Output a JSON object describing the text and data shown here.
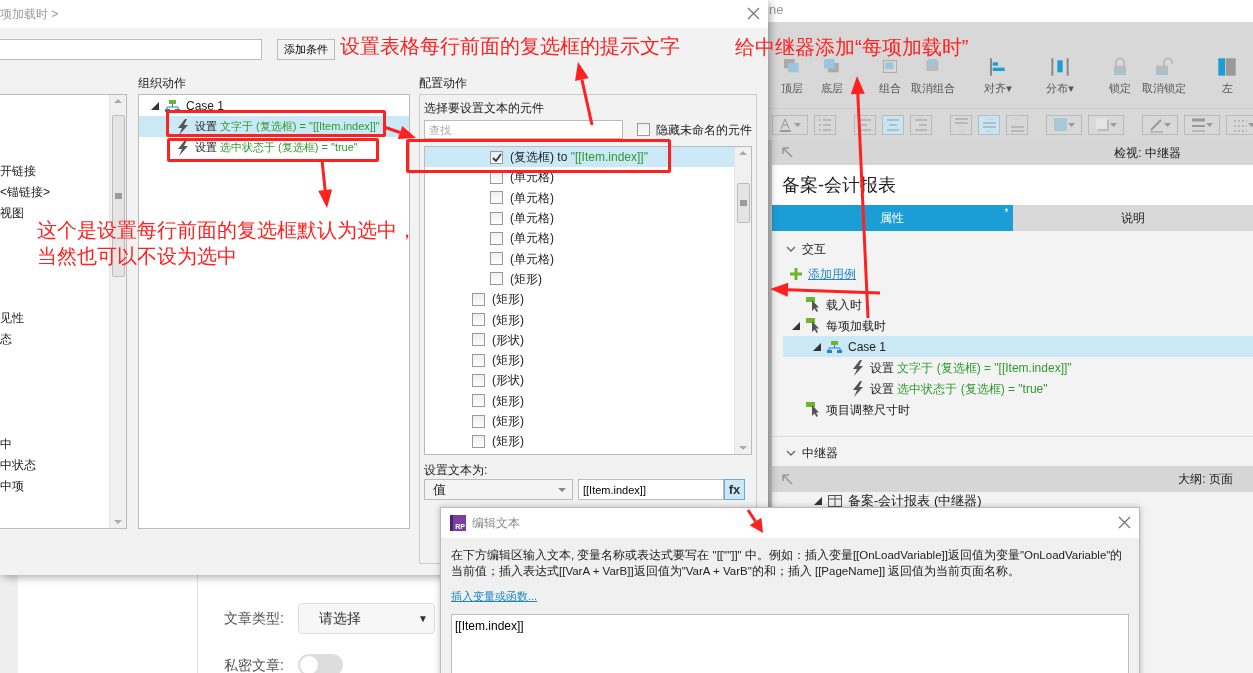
{
  "annotations": [
    {
      "lines": [
        "设置表格每行前面的复选框的提示文字"
      ]
    },
    {
      "lines": [
        "给中继器添加“每项加载时”"
      ]
    },
    {
      "lines": [
        "这个是设置每行前面的复选框默认为选中，",
        "当然也可以不设为选中"
      ]
    }
  ],
  "background_form": {
    "fields": [
      {
        "kind": "select",
        "label": "文章类型:",
        "value": "请选择",
        "caret": "▼"
      },
      {
        "kind": "toggle",
        "label": "私密文章:",
        "on": false
      }
    ]
  },
  "main_window": {
    "title": "ne",
    "toolbar": [
      {
        "kind": "front",
        "label": "顶层"
      },
      {
        "kind": "back",
        "label": "底层"
      },
      {
        "kind": "group",
        "label": "组合"
      },
      {
        "kind": "ungroup",
        "label": "取消组合"
      },
      {
        "kind": "align",
        "label": "对齐",
        "caret": "▾"
      },
      {
        "kind": "distribute",
        "label": "分布",
        "caret": "▾"
      },
      {
        "kind": "lock",
        "label": "锁定"
      },
      {
        "kind": "unlock",
        "label": "取消锁定"
      },
      {
        "kind": "left",
        "label": "左"
      }
    ],
    "format_toolbar": [
      {
        "kind": "font-color",
        "selected": false
      },
      {
        "kind": "bullets",
        "selected": false
      },
      {
        "kind": "align-left",
        "selected": false
      },
      {
        "kind": "align-center",
        "selected": true
      },
      {
        "kind": "align-right",
        "selected": false
      },
      {
        "kind": "align-top",
        "selected": false
      },
      {
        "kind": "align-middle",
        "selected": true
      },
      {
        "kind": "align-bottom",
        "selected": false
      },
      {
        "kind": "fill",
        "selected": false
      },
      {
        "kind": "shadow",
        "selected": false
      },
      {
        "kind": "line-color",
        "selected": false
      },
      {
        "kind": "line-width",
        "selected": false
      },
      {
        "kind": "line-style",
        "selected": false
      }
    ],
    "inspector": {
      "header": "检视: 中继器",
      "widget_name": "备案-会计报表",
      "tabs": [
        {
          "label": "属性",
          "selected": true,
          "marker": "*"
        },
        {
          "label": "说明",
          "selected": false
        }
      ],
      "interactions": {
        "heading": "交互",
        "add_case": "添加用例",
        "events": [
          {
            "label": "载入时",
            "expanded": false
          },
          {
            "label": "每项加载时",
            "expanded": true,
            "cases": [
              {
                "label": "Case 1",
                "selected": true,
                "expanded": true,
                "actions": [
                  {
                    "verb": "设置",
                    "detail": "文字于 (复选框) = \"[[Item.index]]\""
                  },
                  {
                    "verb": "设置",
                    "detail": "选中状态于 (复选框) = \"true\""
                  }
                ]
              }
            ]
          },
          {
            "label": "项目调整尺寸时",
            "expanded": false
          }
        ]
      },
      "repeater_heading": "中继器"
    },
    "outline": {
      "header": "大纲: 页面",
      "items": [
        {
          "label": "备案-会计报表 (中继器)",
          "expanded": true
        }
      ]
    }
  },
  "case_dialog": {
    "title": "项加载时 >",
    "condition_button": "添加条件",
    "action_groups": [
      [
        "开链接",
        "<锚链接>",
        "视图"
      ],
      [
        "见性",
        "态"
      ],
      [
        "中",
        "中状态",
        "中项"
      ]
    ],
    "organize_heading": "组织动作",
    "cases": [
      {
        "label": "Case 1",
        "expanded": true,
        "actions": [
          {
            "verb": "设置",
            "detail": "文字于 (复选框) = \"[[Item.index]]\"",
            "selected": true
          },
          {
            "verb": "设置",
            "detail": "选中状态于 (复选框) = \"true\"",
            "selected": false
          }
        ]
      }
    ],
    "configure_heading": "配置动作",
    "target_heading": "选择要设置文本的元件",
    "search_placeholder": "查找",
    "hide_unnamed": {
      "label": "隐藏未命名的元件",
      "checked": false
    },
    "widgets": [
      {
        "children": [
          {
            "label": "(复选框)",
            "connector": "to",
            "value": "\"[[Item.index]]\"",
            "checked": true,
            "selected": true
          },
          {
            "label": "(单元格)",
            "checked": false,
            "selected": false
          },
          {
            "label": "(单元格)",
            "checked": false,
            "selected": false
          },
          {
            "label": "(单元格)",
            "checked": false,
            "selected": false
          },
          {
            "label": "(单元格)",
            "checked": false,
            "selected": false
          },
          {
            "label": "(单元格)",
            "checked": false,
            "selected": false
          },
          {
            "label": "(矩形)",
            "checked": false,
            "selected": false
          }
        ]
      },
      {
        "label": "(矩形)",
        "checked": false,
        "selected": false
      },
      {
        "label": "(矩形)",
        "checked": false,
        "selected": false
      },
      {
        "label": "(形状)",
        "checked": false,
        "selected": false
      },
      {
        "label": "(矩形)",
        "checked": false,
        "selected": false
      },
      {
        "label": "(形状)",
        "checked": false,
        "selected": false
      },
      {
        "label": "(矩形)",
        "checked": false,
        "selected": false
      },
      {
        "label": "(矩形)",
        "checked": false,
        "selected": false
      },
      {
        "label": "(矩形)",
        "checked": false,
        "selected": false
      }
    ],
    "set_text": {
      "label": "设置文本为:",
      "mode": "值",
      "value": "[[Item.index]]",
      "fx": "fx"
    }
  },
  "edit_dialog": {
    "logo_text": "RP",
    "title": "编辑文本",
    "description": "在下方编辑区输入文本, 变量名称或表达式要写在 \"[[\"\"]]\" 中。例如：插入变量[[OnLoadVariable]]返回值为变量\"OnLoadVariable\"的当前值；插入表达式[[VarA + VarB]]返回值为\"VarA + VarB\"的和；插入 [[PageName]] 返回值为当前页面名称。",
    "insert_link": "插入变量或函数...",
    "value": "[[Item.index]]"
  }
}
